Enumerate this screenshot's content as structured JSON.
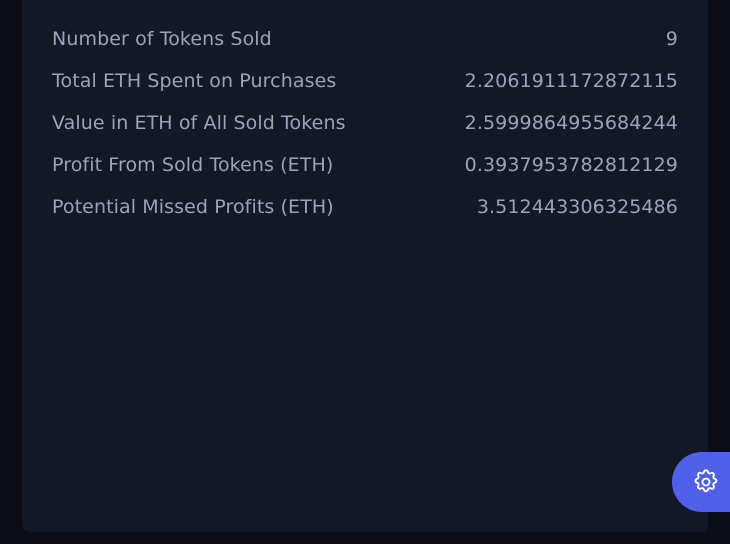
{
  "stats": [
    {
      "label": "Number of Tokens Sold",
      "value": "9"
    },
    {
      "label": "Total ETH Spent on Purchases",
      "value": "2.2061911172872115"
    },
    {
      "label": "Value in ETH of All Sold Tokens",
      "value": "2.5999864955684244"
    },
    {
      "label": "Profit From Sold Tokens (ETH)",
      "value": "0.3937953782812129"
    },
    {
      "label": "Potential Missed Profits (ETH)",
      "value": "3.512443306325486"
    }
  ],
  "settings_button": {
    "icon": "gear-icon"
  },
  "colors": {
    "background": "#0b0e17",
    "card": "#121826",
    "text": "#9ca3b8",
    "accent": "#5060e8"
  }
}
